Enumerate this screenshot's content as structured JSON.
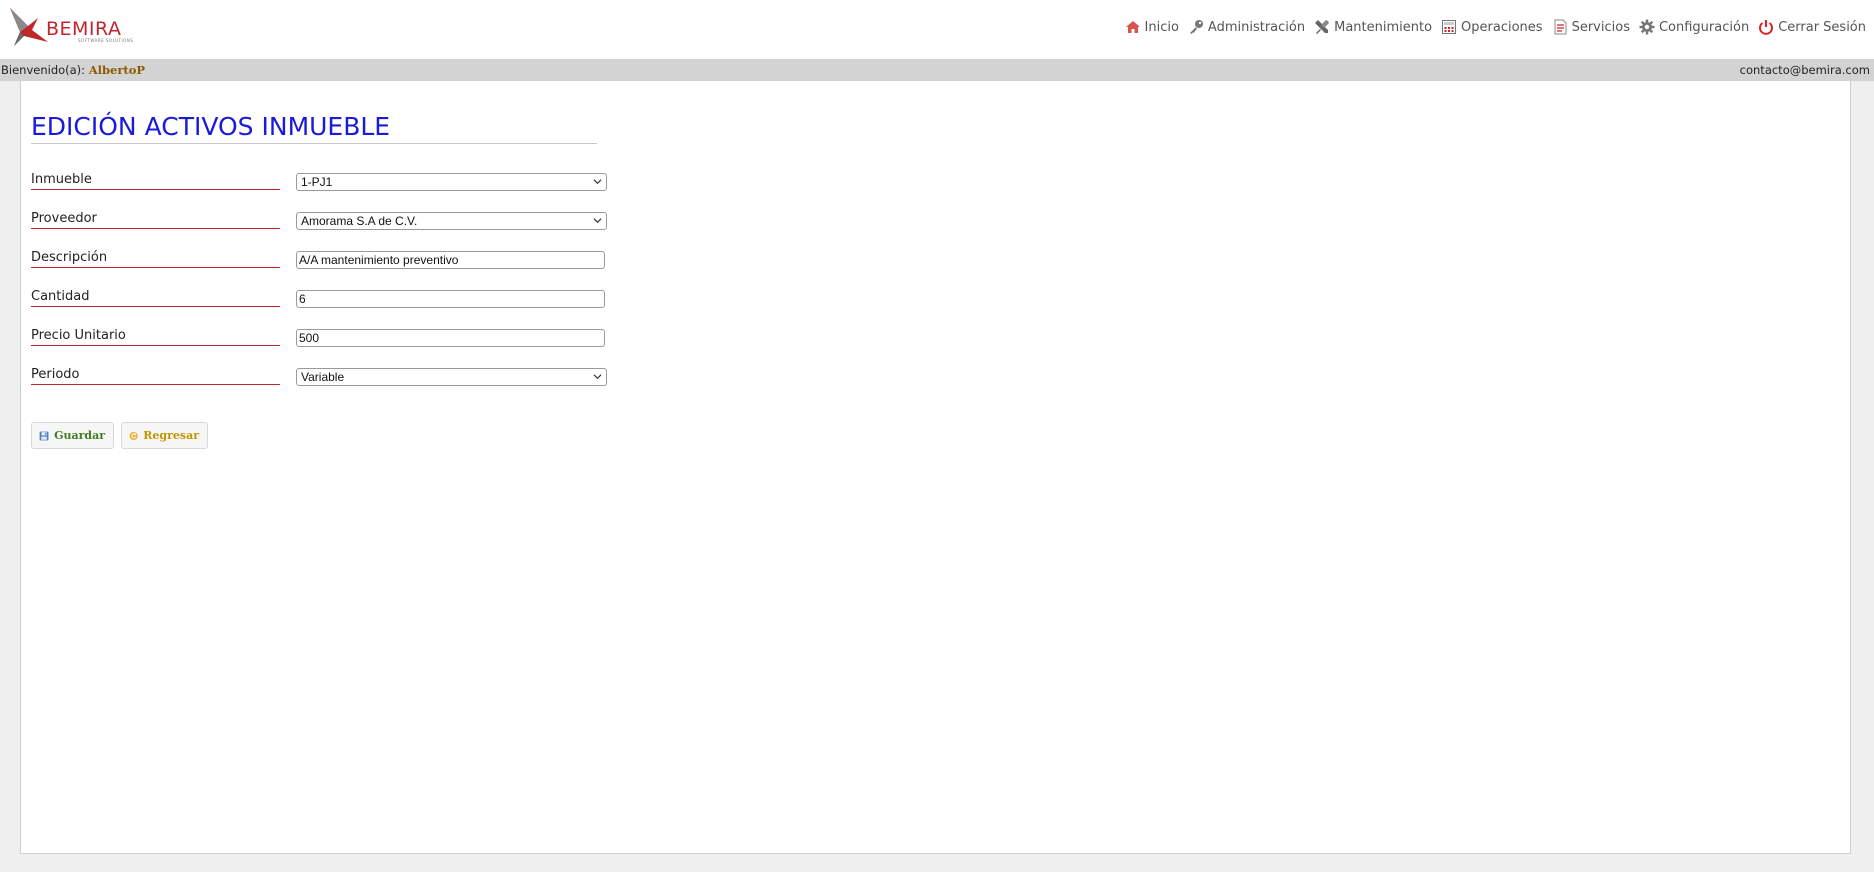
{
  "brand": {
    "name": "BEMIRA",
    "tagline": "SOFTWARE SOLUTIONS",
    "color": "#c0272d"
  },
  "nav": [
    {
      "label": "Inicio",
      "icon": "home-icon"
    },
    {
      "label": "Administración",
      "icon": "key-icon"
    },
    {
      "label": "Mantenimiento",
      "icon": "tools-icon"
    },
    {
      "label": "Operaciones",
      "icon": "calculator-icon"
    },
    {
      "label": "Servicios",
      "icon": "document-icon"
    },
    {
      "label": "Configuración",
      "icon": "gear-icon"
    },
    {
      "label": "Cerrar Sesión",
      "icon": "power-icon"
    }
  ],
  "welcome": {
    "prefix": "Bienvenido(a):",
    "user": "AlbertoP",
    "contact": "contacto@bemira.com"
  },
  "page": {
    "title": "EDICIÓN ACTIVOS INMUEBLE"
  },
  "form": {
    "inmueble": {
      "label": "Inmueble",
      "value": "1-PJ1"
    },
    "proveedor": {
      "label": "Proveedor",
      "value": "Amorama S.A de C.V."
    },
    "descripcion": {
      "label": "Descripción",
      "value": "A/A mantenimiento preventivo"
    },
    "cantidad": {
      "label": "Cantidad",
      "value": "6"
    },
    "precio": {
      "label": "Precio Unitario",
      "value": "500"
    },
    "periodo": {
      "label": "Periodo",
      "value": "Variable"
    }
  },
  "buttons": {
    "save": "Guardar",
    "back": "Regresar"
  },
  "colors": {
    "title": "#1a1adb",
    "label_underline": "#c0272d",
    "save": "#3f7d1f",
    "back": "#c29600",
    "welcome_bar": "#d3d3d3"
  }
}
